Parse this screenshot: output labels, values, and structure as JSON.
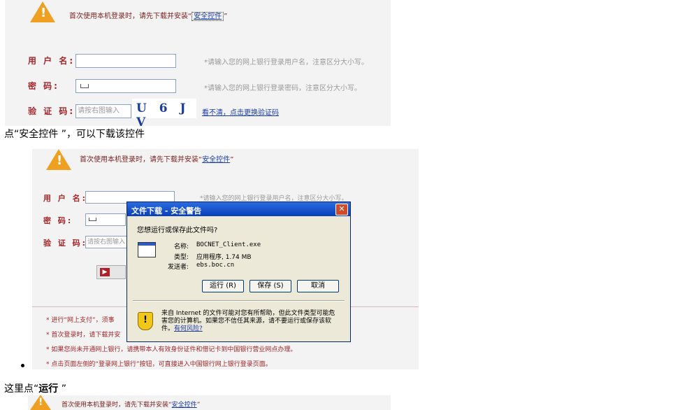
{
  "section1": {
    "notice_text": "首次使用本机登录时，请先下载并安装“",
    "notice_link": "安全控件",
    "notice_close": "”",
    "username_label": "用 户 名:",
    "username_hint": "*请输入您的网上银行登录用户名，注意区分大小写。",
    "password_label": "密    码:",
    "password_hint": "*请输入您的网上银行登录密码，注意区分大小写。",
    "captcha_label": "验 证 码:",
    "captcha_placeholder": "请按右图输入",
    "captcha_text": "U 6 J V",
    "captcha_refresh": "看不清，点击更换验证码"
  },
  "caption1": "点“安全控件 ”，可以下载该控件",
  "section2": {
    "notice_text": "首次使用本机登录时，请先下载并安装“",
    "notice_link": "安全控件",
    "notice_close": "”",
    "username_label": "用 户 名:",
    "username_hint": "*请输入您的网上银行登录用户名，注意区分大小写。",
    "password_label": "密    码:",
    "captcha_label": "验 证 码:",
    "captcha_placeholder": "请按右图输入",
    "bottom_items": [
      "* 进行“网上支付”，须事",
      "* 首次登录时，请下载并安",
      "* 如果您尚未开通网上银行，请携带本人有效身份证件和借记卡到中国银行营业网点办理。",
      "* 点击页面左侧的“登录网上银行”按钮，可直接进入中国银行网上银行登录页面。"
    ]
  },
  "dialog": {
    "title": "文件下载 - 安全警告",
    "close": "✕",
    "question": "您想运行或保存此文件吗?",
    "name_label": "名称:",
    "name_value": "BOCNET_Client.exe",
    "type_label": "类型:",
    "type_value": "应用程序, 1.74 MB",
    "from_label": "发送者:",
    "from_value": "ebs.boc.cn",
    "run_button": "运行 (R)",
    "save_button": "保存 (S)",
    "cancel_button": "取消",
    "warning_text": "来自 Internet 的文件可能对您有所帮助，但此文件类型可能危害您的计算机。如果您不信任其来源，请不要运行或保存该软件。",
    "risk_link": "有何风险?"
  },
  "caption2_prefix": "这里点“",
  "caption2_bold": "运行",
  "caption2_suffix": " ”",
  "section3": {
    "notice_text": "首次使用本机登录时，请先下载并安装“",
    "notice_link": "安全控件",
    "notice_close": "”"
  },
  "colors": {
    "panel_bg": "#f3f3f3",
    "label_red": "#a6262a",
    "link_blue": "#1a3ca8",
    "warning_orange": "#f0a020",
    "dialog_title_blue": "#0a3fb8"
  }
}
